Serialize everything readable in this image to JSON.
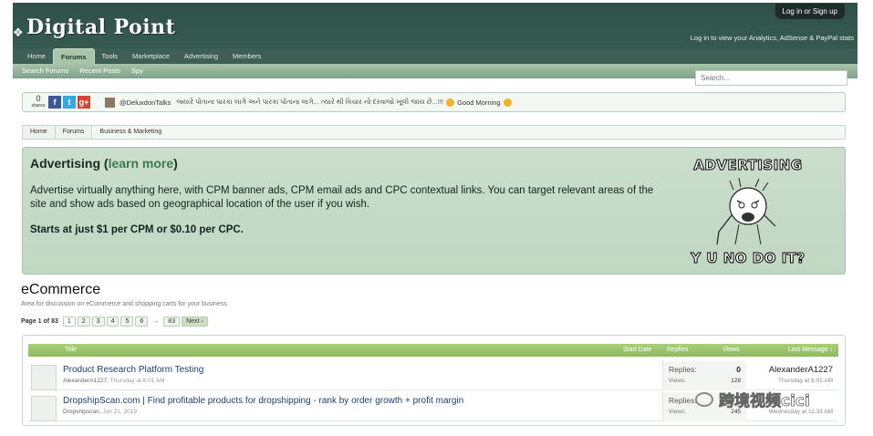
{
  "header": {
    "site_name": "Digital Point",
    "login_button": "Log in or Sign up",
    "login_tagline": "Log in to view your Analytics, AdSense & PayPal stats"
  },
  "nav": {
    "tabs": [
      {
        "label": "Home"
      },
      {
        "label": "Forums"
      },
      {
        "label": "Tools"
      },
      {
        "label": "Marketplace"
      },
      {
        "label": "Advertising"
      },
      {
        "label": "Members"
      }
    ],
    "active_tab": "Forums",
    "subnav": [
      {
        "label": "Search Forums"
      },
      {
        "label": "Recent Posts"
      },
      {
        "label": "Spy"
      }
    ],
    "search_placeholder": "Search..."
  },
  "social_bar": {
    "count": "0",
    "count_label": "shares",
    "icons": [
      "facebook-icon",
      "twitter-icon",
      "google-plus-icon"
    ],
    "tweet_handle": "@DeluxdonTalks",
    "tweet_text": "જ્યારે પોતાના પારકા લાગે અને પારકા પોતાના લાગે... ત્યારે થી વિચાર નો દરવાજો ખૂલી જાય છે...!!!",
    "tweet_tail": "Good Morning"
  },
  "breadcrumb": [
    "Home",
    "Forums",
    "Business & Marketing"
  ],
  "ad": {
    "title": "Advertising",
    "link_text": "learn more",
    "body": "Advertise virtually anything here, with CPM banner ads, CPM email ads and CPC contextual links. You can target relevant areas of the site and show ads based on geographical location of the user if you wish.",
    "price": "Starts at just $1 per CPM or $0.10 per CPC.",
    "meme_top": "ADVERTISING",
    "meme_bottom": "Y U NO DO IT?"
  },
  "forum": {
    "title": "eCommerce",
    "description": "Area for discussion on eCommerce and shopping carts for your business.",
    "pager_label": "Page 1 of 83",
    "pages": [
      "1",
      "2",
      "3",
      "4",
      "5",
      "6"
    ],
    "arrow": "→",
    "last_page": "83",
    "next_label": "Next ›"
  },
  "threads": {
    "columns": {
      "title": "Title",
      "start_date": "Start Date",
      "replies": "Replies",
      "views": "Views",
      "last_message": "Last Message ↓"
    },
    "rows": [
      {
        "title": "Product Research Platform Testing",
        "author": "AlexanderA1227",
        "date": "Thursday at 6:01 AM",
        "replies_label": "Replies:",
        "replies": "0",
        "views_label": "Views:",
        "views": "128",
        "last_user": "AlexanderA1227",
        "last_date": "Thursday at 6:01 AM"
      },
      {
        "title": "DropshipScan.com | Find profitable products for dropshipping - rank by order growth + profit margin",
        "author": "Dropshipscan",
        "date": "Jun 21, 2019",
        "replies_label": "Replies:",
        "replies": "",
        "views_label": "Views:",
        "views": "245",
        "last_user": "",
        "last_date": "Wednesday at 11:33 AM"
      }
    ]
  },
  "watermark": "跨境视频cici"
}
